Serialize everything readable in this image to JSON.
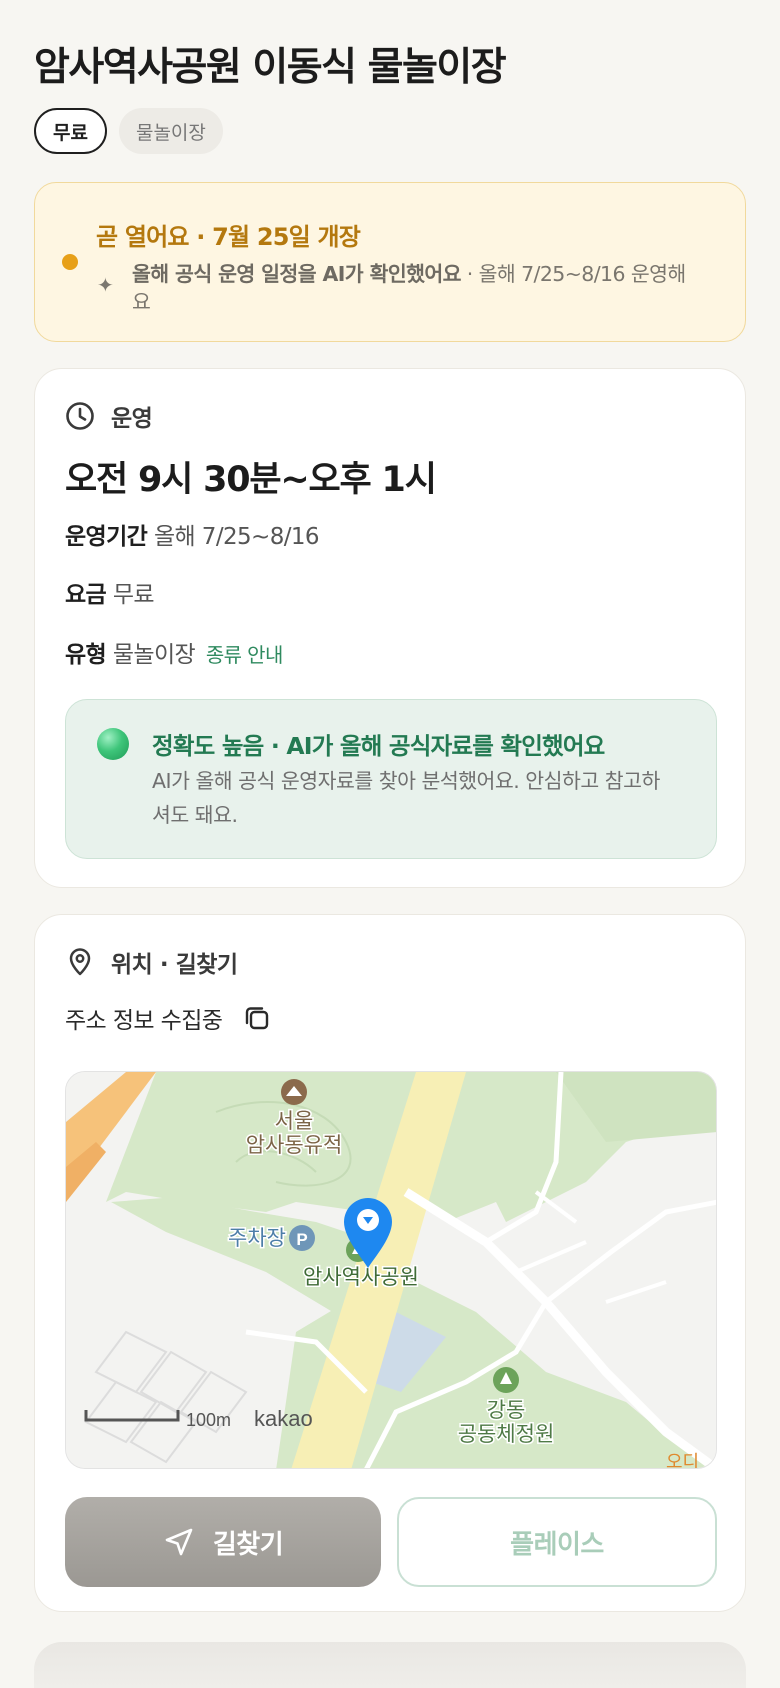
{
  "page": {
    "title": "암사역사공원 이동식 물놀이장",
    "chips": {
      "price": "무료",
      "type": "물놀이장"
    }
  },
  "notice": {
    "title": "곧 열어요 · 7월 25일 개장",
    "ai_label": "올해 공식 운영 일정을 AI가 확인했어요",
    "detail": " · 올해 7/25~8/16 운영해요",
    "icons": {
      "status": "status-dot-icon",
      "ai": "sparkle-icon"
    },
    "colors": {
      "status": "#e7a019",
      "title": "#b4780e"
    }
  },
  "hours": {
    "section_label": "운영",
    "icon": "clock-icon",
    "main": "오전 9시 30분~오후 1시",
    "period_key": "운영기간",
    "period_value": "올해 7/25~8/16",
    "fee_key": "요금",
    "fee_value": "무료",
    "type_key": "유형",
    "type_value": "물놀이장",
    "type_link": "종류 안내"
  },
  "accuracy": {
    "title": "정확도 높음 · AI가 올해 공식자료를 확인했어요",
    "text": "AI가 올해 공식 운영자료를 찾아 분석했어요. 안심하고 참고하셔도 돼요.",
    "color": "#237a52"
  },
  "location": {
    "section_label": "위치 · 길찾기",
    "icon": "map-pin-icon",
    "address": "주소 정보 수집중",
    "copy_icon": "copy-icon",
    "map": {
      "labels": {
        "heritage": [
          "서울",
          "암사동유적"
        ],
        "parking": "주차장",
        "parking_symbol": "P",
        "park": "암사역사공원",
        "garden": [
          "강동",
          "공동체정원"
        ],
        "edge": "오디"
      },
      "scale": "100m",
      "brand": "kakao",
      "marker_color": "#1e88f0"
    },
    "buttons": {
      "directions": "길찾기",
      "place": "플레이스"
    }
  }
}
